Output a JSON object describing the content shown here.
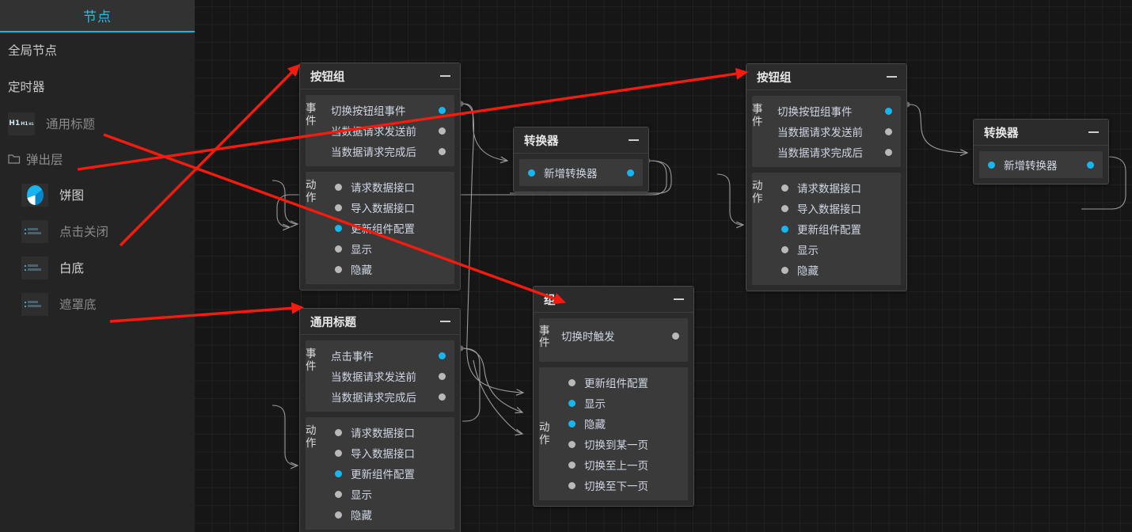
{
  "sidebar": {
    "tab_label": "节点",
    "groups": [
      {
        "name": "global-nodes",
        "label": "全局节点"
      },
      {
        "name": "timer",
        "label": "定时器"
      }
    ],
    "items": [
      {
        "name": "common-title",
        "label": "通用标题",
        "icon": "h1-heading-icon",
        "dim": true,
        "indent": false
      },
      {
        "name": "pie-chart",
        "label": "饼图",
        "icon": "pie-chart-icon",
        "dim": false,
        "indent": true
      },
      {
        "name": "click-close",
        "label": "点击关闭",
        "icon": "list-icon",
        "dim": true,
        "indent": true
      },
      {
        "name": "white-background",
        "label": "白底",
        "icon": "list-icon",
        "dim": false,
        "indent": true
      },
      {
        "name": "mask-background",
        "label": "遮罩底",
        "icon": "list-icon",
        "dim": true,
        "indent": true
      }
    ],
    "folder": {
      "label": "弹出层",
      "icon": "folder-icon"
    }
  },
  "canvas": {
    "accent_color": "#17b6ef",
    "annotation_color": "#f41b0f",
    "grid_color": "#232323",
    "minimize_label": "—"
  },
  "nodes": [
    {
      "id": "btngroup-1",
      "title": "按钮组",
      "events_caption": "事件",
      "actions_caption": "动作",
      "events": [
        {
          "label": "切换按钮组事件",
          "active": true
        },
        {
          "label": "当数据请求发送前",
          "active": false
        },
        {
          "label": "当数据请求完成后",
          "active": false
        }
      ],
      "actions": [
        {
          "label": "请求数据接口",
          "active": false
        },
        {
          "label": "导入数据接口",
          "active": false
        },
        {
          "label": "更新组件配置",
          "active": true
        },
        {
          "label": "显示",
          "active": false
        },
        {
          "label": "隐藏",
          "active": false
        }
      ]
    },
    {
      "id": "converter-1",
      "title": "转换器",
      "actions": [
        {
          "label": "新增转换器",
          "active": true
        }
      ]
    },
    {
      "id": "btngroup-2",
      "title": "按钮组",
      "events_caption": "事件",
      "actions_caption": "动作",
      "events": [
        {
          "label": "切换按钮组事件",
          "active": true
        },
        {
          "label": "当数据请求发送前",
          "active": false
        },
        {
          "label": "当数据请求完成后",
          "active": false
        }
      ],
      "actions": [
        {
          "label": "请求数据接口",
          "active": false
        },
        {
          "label": "导入数据接口",
          "active": false
        },
        {
          "label": "更新组件配置",
          "active": true
        },
        {
          "label": "显示",
          "active": false
        },
        {
          "label": "隐藏",
          "active": false
        }
      ]
    },
    {
      "id": "converter-2",
      "title": "转换器",
      "actions": [
        {
          "label": "新增转换器",
          "active": true
        }
      ]
    },
    {
      "id": "title-1",
      "title": "通用标题",
      "events_caption": "事件",
      "actions_caption": "动作",
      "events": [
        {
          "label": "点击事件",
          "active": true
        },
        {
          "label": "当数据请求发送前",
          "active": false
        },
        {
          "label": "当数据请求完成后",
          "active": false
        }
      ],
      "actions": [
        {
          "label": "请求数据接口",
          "active": false
        },
        {
          "label": "导入数据接口",
          "active": false
        },
        {
          "label": "更新组件配置",
          "active": true
        },
        {
          "label": "显示",
          "active": false
        },
        {
          "label": "隐藏",
          "active": false
        }
      ]
    },
    {
      "id": "group",
      "title": "组",
      "events_caption": "事件",
      "actions_caption": "动作",
      "events": [
        {
          "label": "切换时触发",
          "active": false
        }
      ],
      "actions": [
        {
          "label": "更新组件配置",
          "active": false
        },
        {
          "label": "显示",
          "active": true
        },
        {
          "label": "隐藏",
          "active": true
        },
        {
          "label": "切换到某一页",
          "active": false
        },
        {
          "label": "切换至上一页",
          "active": false
        },
        {
          "label": "切换至下一页",
          "active": false
        }
      ]
    }
  ]
}
